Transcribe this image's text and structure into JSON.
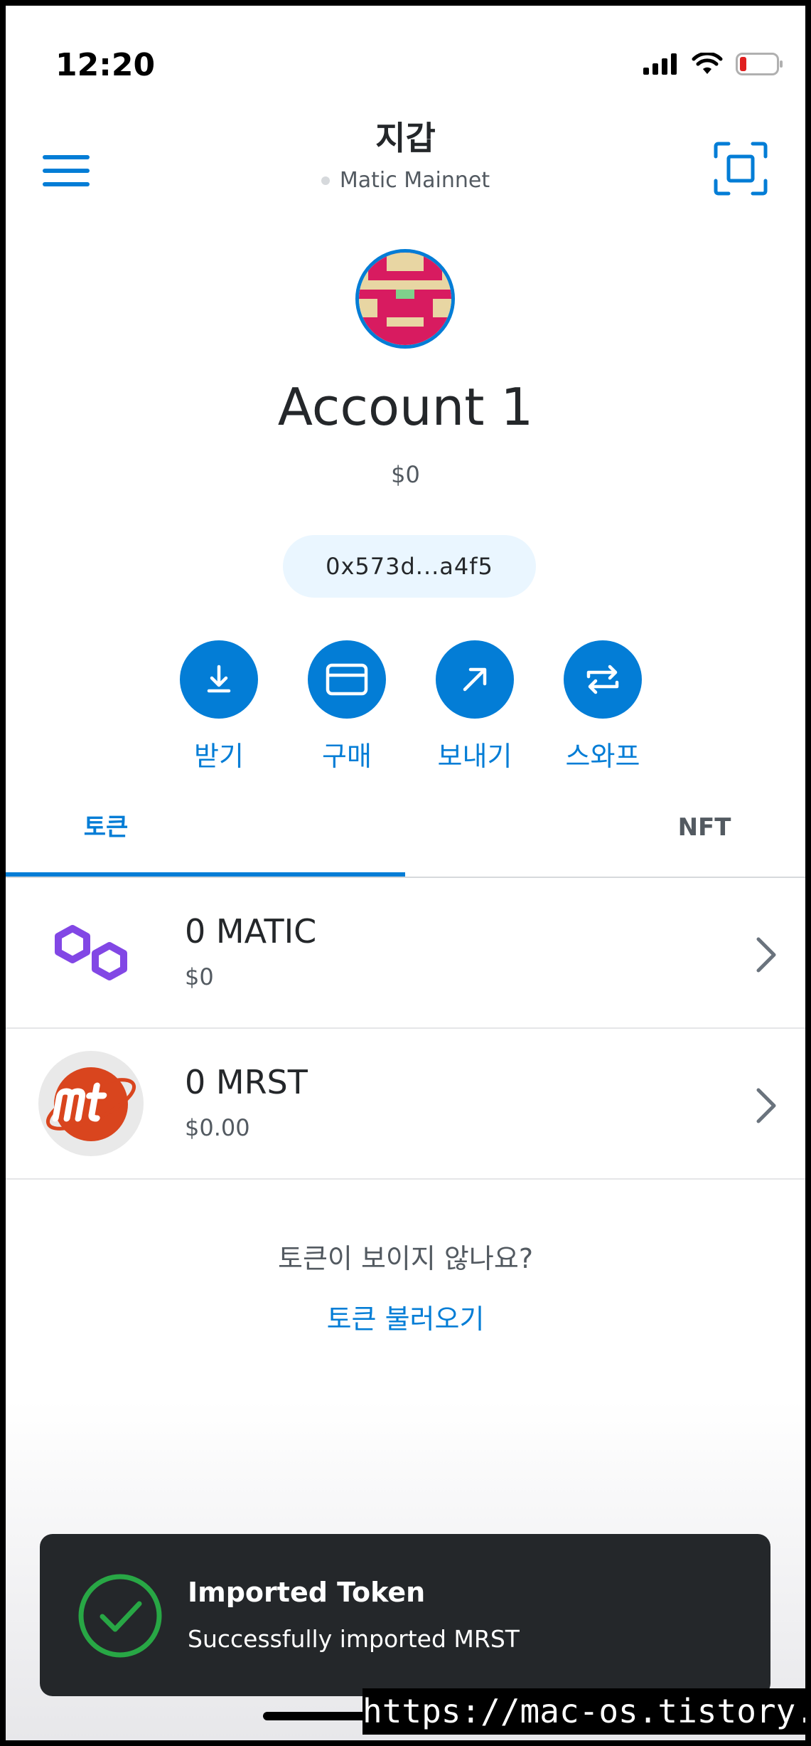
{
  "status_bar": {
    "time": "12:20"
  },
  "header": {
    "title": "지갑",
    "network": "Matic Mainnet"
  },
  "account": {
    "name": "Account 1",
    "balance": "$0",
    "address": "0x573d...a4f5"
  },
  "actions": [
    {
      "label": "받기",
      "icon": "receive-icon"
    },
    {
      "label": "구매",
      "icon": "card-icon"
    },
    {
      "label": "보내기",
      "icon": "send-arrow-icon"
    },
    {
      "label": "스와프",
      "icon": "swap-icon"
    }
  ],
  "tabs": [
    {
      "label": "토큰"
    },
    {
      "label": "NFT"
    }
  ],
  "tokens": [
    {
      "amount": "0 MATIC",
      "fiat": "$0",
      "icon": "polygon-logo-icon"
    },
    {
      "amount": "0 MRST",
      "fiat": "$0.00",
      "icon": "mrst-logo-icon"
    }
  ],
  "import_prompt": {
    "question": "토큰이 보이지 않나요?",
    "link": "토큰 불러오기"
  },
  "toast": {
    "title": "Imported Token",
    "message": "Successfully imported MRST"
  },
  "watermark": "https://mac-os.tistory.com",
  "colors": {
    "accent": "#037dd6",
    "text": "#24272a",
    "muted": "#535a61",
    "toast_bg": "#24272a",
    "success": "#28a745",
    "matic": "#8247e5",
    "mrst": "#d9451e"
  }
}
